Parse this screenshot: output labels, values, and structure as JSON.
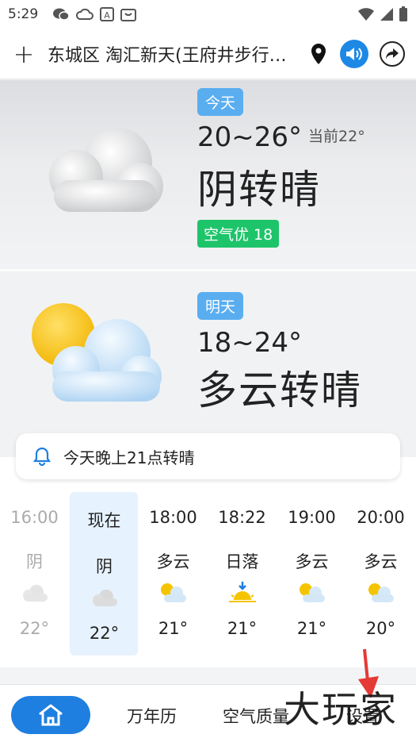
{
  "status_bar": {
    "time": "5:29"
  },
  "header": {
    "add_label": "+",
    "location": "东城区 淘汇新天(王府井步行街店)"
  },
  "today": {
    "badge": "今天",
    "temp_range": "20~26°",
    "current": "当前22°",
    "condition": "阴转晴",
    "aqi": "空气优 18",
    "icon": "cloudy-icon"
  },
  "tomorrow": {
    "badge": "明天",
    "temp_range": "18~24°",
    "condition": "多云转晴",
    "icon": "partly-cloudy-icon"
  },
  "notice": {
    "text": "今天晚上21点转晴"
  },
  "hourly": [
    {
      "time": "16:00",
      "cond": "阴",
      "temp": "22°",
      "icon": "cloud-icon"
    },
    {
      "time": "现在",
      "cond": "阴",
      "temp": "22°",
      "icon": "cloud-icon"
    },
    {
      "time": "18:00",
      "cond": "多云",
      "temp": "21°",
      "icon": "partly-cloudy-icon"
    },
    {
      "time": "18:22",
      "cond": "日落",
      "temp": "21°",
      "icon": "sunset-icon"
    },
    {
      "time": "19:00",
      "cond": "多云",
      "temp": "21°",
      "icon": "partly-cloudy-icon"
    },
    {
      "time": "20:00",
      "cond": "多云",
      "temp": "20°",
      "icon": "partly-cloudy-icon"
    }
  ],
  "bottom_nav": {
    "calendar": "万年历",
    "air_quality": "空气质量",
    "settings": "设置"
  },
  "watermark": "大玩家",
  "colors": {
    "accent": "#1e7fe0",
    "badge_blue": "#5aaef0",
    "aqi_green": "#1ec46a"
  }
}
